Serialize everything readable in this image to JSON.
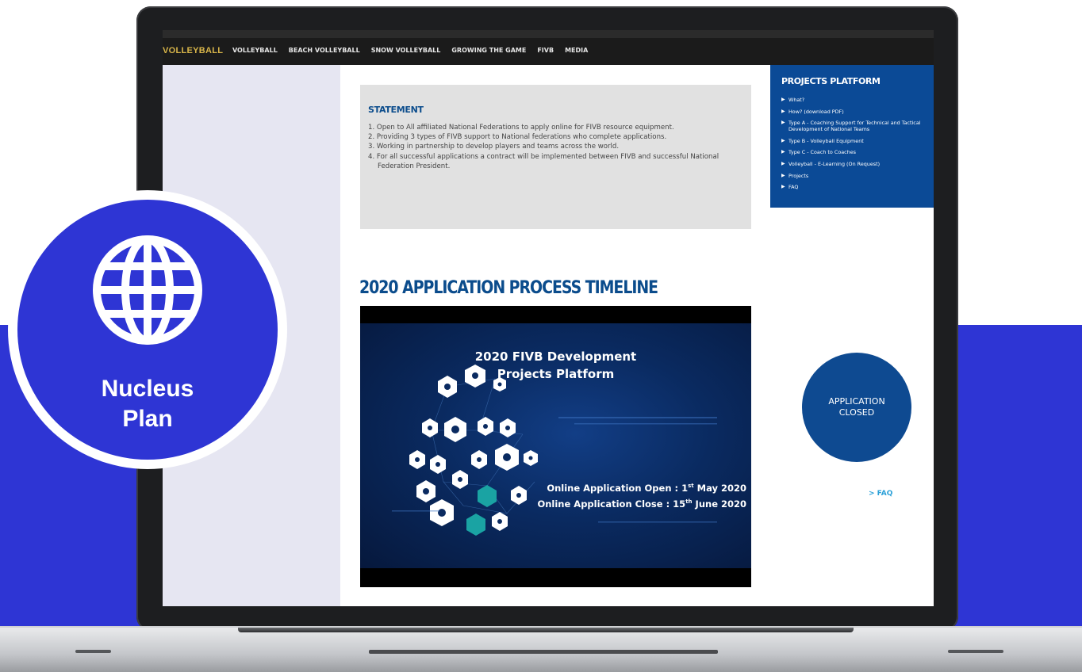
{
  "colors": {
    "accent_blue": "#2e35d4",
    "fivb_blue": "#0b4a96",
    "title_blue": "#0b4c8c",
    "faq_link": "#2aa0d8"
  },
  "nav": {
    "logo": "VOLLEYBALL",
    "links": [
      "VOLLEYBALL",
      "BEACH VOLLEYBALL",
      "SNOW VOLLEYBALL",
      "GROWING THE GAME",
      "FIVB",
      "MEDIA"
    ]
  },
  "statement": {
    "title": "STATEMENT",
    "items": [
      "1. Open to All affiliated National Federations to apply online for FIVB resource equipment.",
      "2. Providing 3 types of FIVB support to National federations who complete applications.",
      "3. Working in partnership to develop players and teams across the world.",
      "4. For all successful applications a contract will be implemented between FIVB and successful National Federation President."
    ]
  },
  "sidebar": {
    "title": "PROJECTS PLATFORM",
    "items": [
      "What?",
      "How? (download PDF)",
      "Type A - Coaching Support for Technical and Tactical Development of National Teams",
      "Type B - Volleyball Equipment",
      "Type C - Coach to Coaches",
      "Volleyball - E-Learning (On Request)",
      "Projects",
      "FAQ"
    ]
  },
  "timeline": {
    "title": "2020 APPLICATION PROCESS TIMELINE",
    "video_title_line1": "2020 FIVB Development",
    "video_title_line2": "Projects Platform",
    "open_text": "Online Application Open : 1",
    "open_sup": "st",
    "open_rest": " May 2020",
    "close_text": "Online Application Close : 15",
    "close_sup": "th",
    "close_rest": " June 2020"
  },
  "status": {
    "line1": "APPLICATION",
    "line2": "CLOSED"
  },
  "faq_link": "> FAQ",
  "badge": {
    "icon": "globe-icon",
    "line1": "Nucleus",
    "line2": "Plan"
  }
}
